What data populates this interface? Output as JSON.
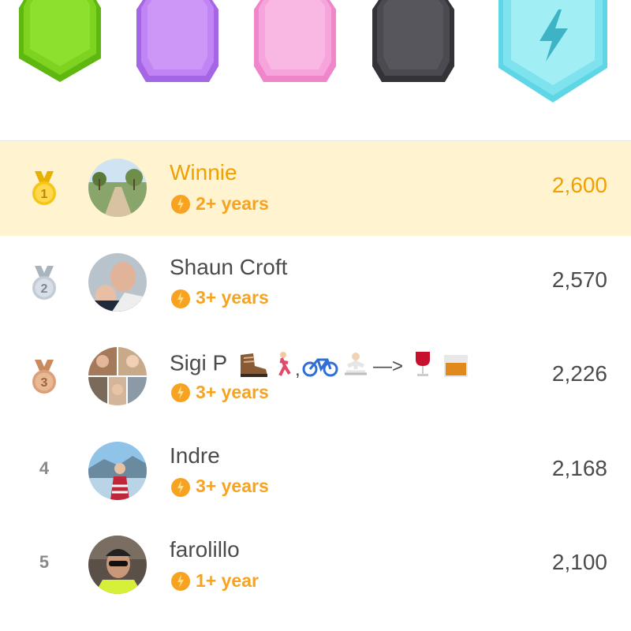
{
  "leagues": [
    {
      "name": "green-league",
      "color": "#7ed321"
    },
    {
      "name": "purple-league",
      "color": "#c084f5"
    },
    {
      "name": "pink-league",
      "color": "#f6a4dc"
    },
    {
      "name": "obsidian-league",
      "color": "#4a4a50"
    },
    {
      "name": "diamond-league",
      "color": "#7fe3ef",
      "icon": "lightning-icon"
    }
  ],
  "leaderboard": [
    {
      "rank": "1",
      "name": "Winnie",
      "streak": "2+ years",
      "xp": "2,600",
      "medal": "gold",
      "highlight": true
    },
    {
      "rank": "2",
      "name": "Shaun Croft",
      "streak": "3+ years",
      "xp": "2,570",
      "medal": "silver"
    },
    {
      "rank": "3",
      "name": "Sigi P",
      "name_suffix": "—>",
      "streak": "3+ years",
      "xp": "2,226",
      "medal": "bronze",
      "emoji_icons": [
        "hiking-boot-icon",
        "runner-icon",
        "bicycle-icon",
        "yoga-icon",
        "wine-glass-icon",
        "whisky-glass-icon"
      ]
    },
    {
      "rank": "4",
      "name": "Indre",
      "streak": "3+ years",
      "xp": "2,168"
    },
    {
      "rank": "5",
      "name": "farolillo",
      "streak": "1+ year",
      "xp": "2,100"
    }
  ],
  "colors": {
    "highlight_bg": "#fff4cf",
    "accent": "#f0a000",
    "streak": "#f7a321"
  }
}
